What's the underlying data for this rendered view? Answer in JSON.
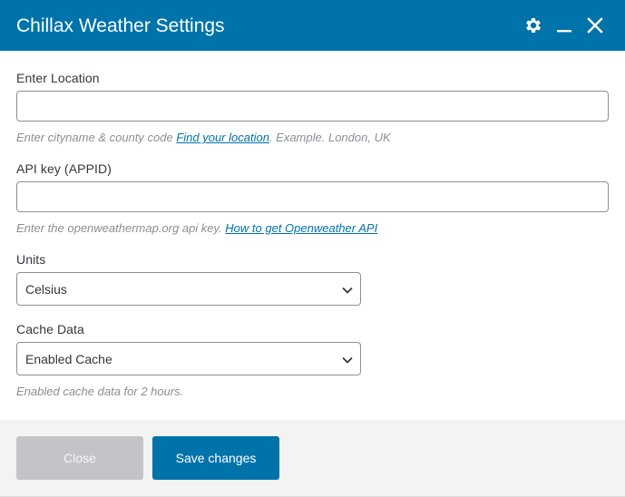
{
  "header": {
    "title": "Chillax Weather Settings",
    "icons": [
      "gear-icon",
      "minimize-icon",
      "close-icon"
    ]
  },
  "form": {
    "location": {
      "label": "Enter Location",
      "value": "",
      "help_prefix": "Enter cityname & county code ",
      "help_link": "Find your location",
      "help_suffix": ". Example. London, UK"
    },
    "api_key": {
      "label": "API key (APPID)",
      "value": "",
      "help_prefix": "Enter the openweathermap.org api key. ",
      "help_link": "How to get Openweather API"
    },
    "units": {
      "label": "Units",
      "selected": "Celsius"
    },
    "cache": {
      "label": "Cache Data",
      "selected": "Enabled Cache",
      "help": "Enabled cache data for 2 hours."
    }
  },
  "footer": {
    "close_label": "Close",
    "save_label": "Save changes"
  },
  "colors": {
    "accent": "#0073aa",
    "disabled_button": "#c3c4c7",
    "footer_bg": "#f3f3f3"
  }
}
